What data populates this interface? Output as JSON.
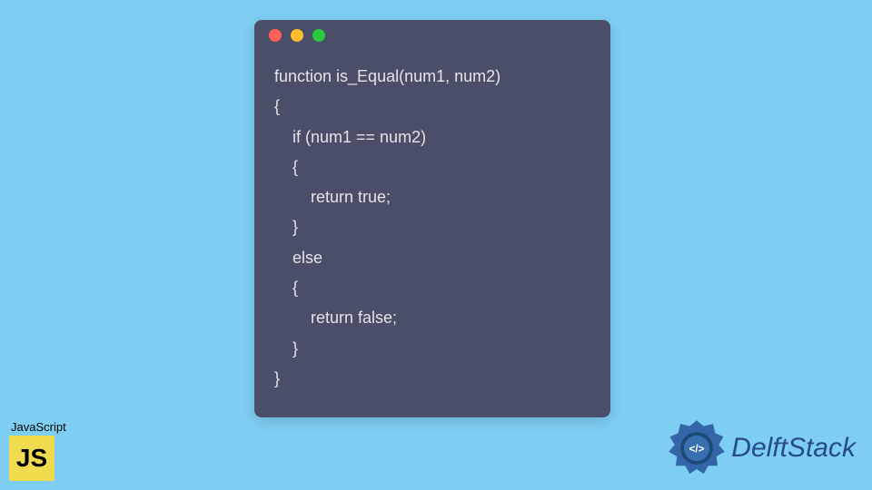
{
  "window": {
    "dots": [
      "red",
      "yellow",
      "green"
    ]
  },
  "code": {
    "lines": [
      "function is_Equal(num1, num2)",
      "{",
      "    if (num1 == num2)",
      "    {",
      "        return true;",
      "    }",
      "    else",
      "    {",
      "        return false;",
      "    }",
      "}"
    ]
  },
  "jsBadge": {
    "label": "JavaScript",
    "logoText": "JS"
  },
  "brand": {
    "name": "DelftStack"
  }
}
